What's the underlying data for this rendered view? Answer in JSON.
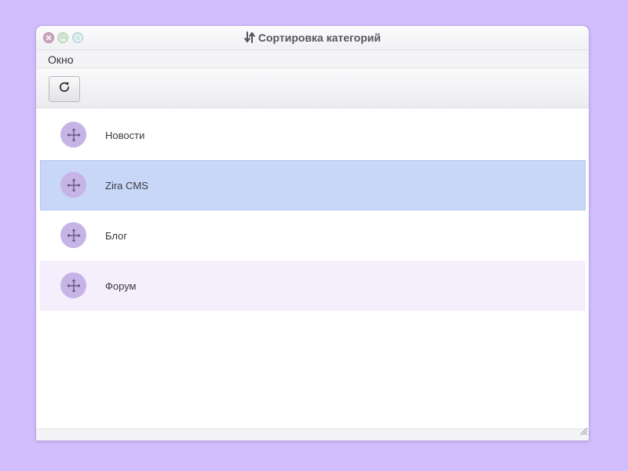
{
  "window": {
    "title": "Сортировка категорий",
    "title_icon": "sort-arrows-icon",
    "controls": [
      "close",
      "minimize",
      "maximize"
    ]
  },
  "menubar": {
    "items": [
      {
        "label": "Окно"
      }
    ]
  },
  "toolbar": {
    "refresh_icon": "refresh-icon"
  },
  "list": {
    "items": [
      {
        "label": "Новости",
        "state": "normal"
      },
      {
        "label": "Zira CMS",
        "state": "selected"
      },
      {
        "label": "Блог",
        "state": "normal"
      },
      {
        "label": "Форум",
        "state": "hover"
      }
    ],
    "handle_icon": "move-arrows-icon"
  },
  "colors": {
    "background": "#d2bdfd",
    "selected_row": "#c8d7f7",
    "hover_row": "#f5eefc",
    "handle": "#c6b4e6"
  }
}
